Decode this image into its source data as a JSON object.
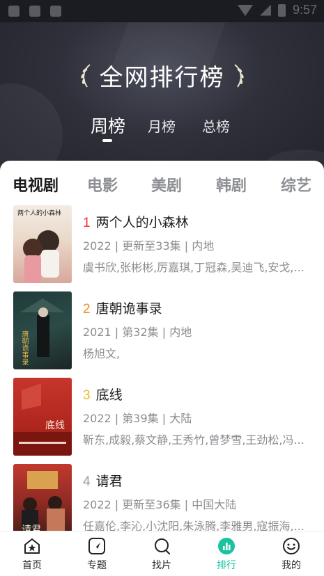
{
  "status_bar": {
    "time": "9:57"
  },
  "header": {
    "title": "全网排行榜",
    "tabs": [
      {
        "label": "周榜",
        "active": true
      },
      {
        "label": "月榜",
        "active": false
      },
      {
        "label": "总榜",
        "active": false
      }
    ]
  },
  "categories": [
    {
      "label": "电视剧",
      "active": true
    },
    {
      "label": "电影",
      "active": false
    },
    {
      "label": "美剧",
      "active": false
    },
    {
      "label": "韩剧",
      "active": false
    },
    {
      "label": "综艺",
      "active": false
    }
  ],
  "items": [
    {
      "rank": "1",
      "rank_color": "#f0363b",
      "title": "两个人的小森林",
      "meta": "2022 | 更新至33集 | 内地",
      "cast": "虞书欣,张彬彬,厉嘉琪,丁冠森,吴迪飞,安戈,...",
      "poster_text": "两个人的小森林"
    },
    {
      "rank": "2",
      "rank_color": "#f08c22",
      "title": "唐朝诡事录",
      "meta": "2021 | 第32集 | 内地",
      "cast": "杨旭文,",
      "poster_text": "唐朝诡事录"
    },
    {
      "rank": "3",
      "rank_color": "#f2b824",
      "title": "底线",
      "meta": "2022 | 第39集 | 大陆",
      "cast": "靳东,成毅,蔡文静,王秀竹,曾梦雪,王劲松,冯...",
      "poster_text": "底线"
    },
    {
      "rank": "4",
      "rank_color": "#9a9ca0",
      "title": "请君",
      "meta": "2022 | 更新至36集 | 中国大陆",
      "cast": "任嘉伦,李沁,小沈阳,朱泳腾,李雅男,寇振海,...",
      "poster_text": "请君"
    }
  ],
  "bottom_nav": [
    {
      "label": "首页",
      "icon": "home-icon",
      "active": false
    },
    {
      "label": "专题",
      "icon": "topic-icon",
      "active": false
    },
    {
      "label": "找片",
      "icon": "search-icon",
      "active": false
    },
    {
      "label": "排行",
      "icon": "ranking-icon",
      "active": true
    },
    {
      "label": "我的",
      "icon": "profile-icon",
      "active": false
    }
  ],
  "colors": {
    "accent": "#19c39d",
    "header_dark": "#2f303a"
  }
}
